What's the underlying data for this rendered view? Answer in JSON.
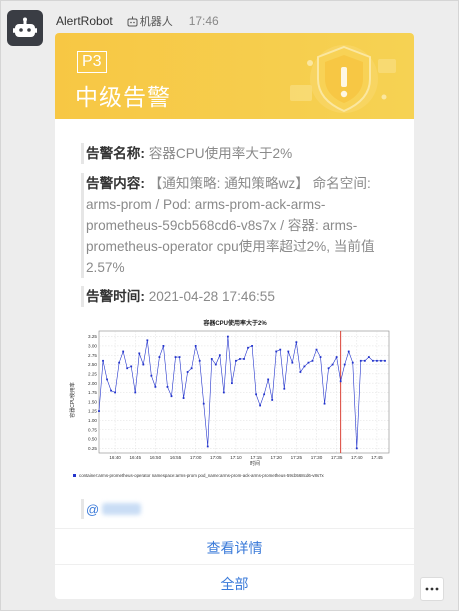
{
  "message": {
    "sender": "AlertRobot",
    "tag": "机器人",
    "time": "17:46"
  },
  "card": {
    "level": "P3",
    "title": "中级告警",
    "fields": {
      "name_label": "告警名称:",
      "name_value": "容器CPU使用率大于2%",
      "content_label": "告警内容:",
      "content_value": "【通知策略: 通知策略wz】 命名空间: arms-prom / Pod: arms-prom-ack-arms-prometheus-59cb568cd6-v8s7x / 容器: arms-prometheus-operator cpu使用率超过2%, 当前值2.57%",
      "time_label": "告警时间:",
      "time_value": "2021-04-28 17:46:55"
    },
    "mention": "@",
    "actions": {
      "details": "查看详情",
      "all": "全部"
    },
    "colors": {
      "banner": "#f7c744",
      "link": "#3a7ad9",
      "series": "#2233cc",
      "marker": "#d62d20"
    }
  },
  "chart_data": {
    "type": "line",
    "title": "容器CPU使用率大于2%",
    "xlabel": "时间",
    "ylabel": "容器CPU使用率",
    "xlim": [
      0,
      72
    ],
    "ylim": [
      0.125,
      3.4
    ],
    "yticks": [
      0.25,
      0.5,
      0.75,
      1.0,
      1.25,
      1.5,
      1.75,
      2.0,
      2.25,
      2.5,
      2.75,
      3.0,
      3.25
    ],
    "ytick_labels": [
      "0.25",
      "0.50",
      "0.75",
      "1.00",
      "1.25",
      "1.50",
      "1.75",
      "2.00",
      "2.25",
      "2.50",
      "2.75",
      "3.00",
      "3.25"
    ],
    "xticks": [
      4,
      9,
      14,
      19,
      24,
      29,
      34,
      39,
      44,
      49,
      54,
      59,
      64,
      69
    ],
    "xtick_labels": [
      "16:40",
      "16:45",
      "16:50",
      "16:55",
      "17:00",
      "17:05",
      "17:10",
      "17:15",
      "17:20",
      "17:25",
      "17:30",
      "17:35",
      "17:40",
      "17:45"
    ],
    "vline_x": 60,
    "grid": true,
    "legend": "bottom",
    "series": [
      {
        "name": "container:arms-prometheus-operator namespace:arms-prom pod_name:arms-prom-ack-arms-prometheus-59cb568cd6-v8s7x",
        "x": [
          0,
          1,
          2,
          3,
          4,
          5,
          6,
          7,
          8,
          9,
          10,
          11,
          12,
          13,
          14,
          15,
          16,
          17,
          18,
          19,
          20,
          21,
          22,
          23,
          24,
          25,
          26,
          27,
          28,
          29,
          30,
          31,
          32,
          33,
          34,
          35,
          36,
          37,
          38,
          39,
          40,
          41,
          42,
          43,
          44,
          45,
          46,
          47,
          48,
          49,
          50,
          51,
          52,
          53,
          54,
          55,
          56,
          57,
          58,
          59,
          60,
          61,
          62,
          63,
          64,
          65,
          66,
          67,
          68,
          69,
          70,
          71
        ],
        "y": [
          1.25,
          2.6,
          2.1,
          1.8,
          1.75,
          2.55,
          2.85,
          2.4,
          2.45,
          1.75,
          2.8,
          2.5,
          3.15,
          2.2,
          1.9,
          2.7,
          3.0,
          1.9,
          1.65,
          2.7,
          2.7,
          1.6,
          2.3,
          2.4,
          3.0,
          2.6,
          1.45,
          0.3,
          2.65,
          2.5,
          2.75,
          1.75,
          3.25,
          2.0,
          2.6,
          2.65,
          2.65,
          2.95,
          3.0,
          1.7,
          1.4,
          1.7,
          2.1,
          1.55,
          2.85,
          2.9,
          1.85,
          2.85,
          2.55,
          3.1,
          2.3,
          2.45,
          2.55,
          2.6,
          2.9,
          2.7,
          1.45,
          2.4,
          2.5,
          2.7,
          2.05,
          2.5,
          2.85,
          2.55,
          0.25,
          2.6,
          2.6,
          2.7,
          2.6,
          2.6,
          2.6,
          2.6
        ]
      }
    ]
  }
}
